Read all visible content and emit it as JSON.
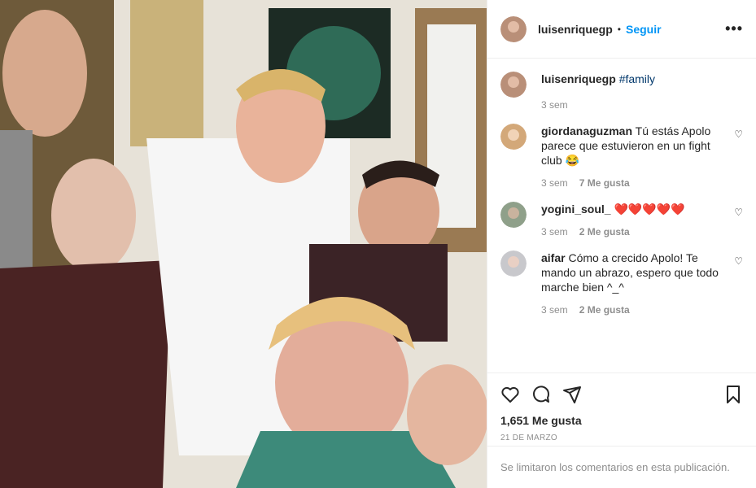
{
  "post": {
    "username": "luisenriquegp",
    "follow_label": "Seguir",
    "caption_tag": "#family",
    "caption_time": "3 sem",
    "likes": "1,651 Me gusta",
    "date": "21 DE MARZO",
    "comments_limited": "Se limitaron los comentarios en esta publicación."
  },
  "comments": [
    {
      "user": "giordanaguzman",
      "text": "Tú estás Apolo parece que estuvieron en un fight club 😂",
      "time": "3 sem",
      "likes": "7 Me gusta"
    },
    {
      "user": "yogini_soul_",
      "text": "❤️❤️❤️❤️❤️",
      "time": "3 sem",
      "likes": "2 Me gusta"
    },
    {
      "user": "aifar",
      "text": "Cómo a crecido Apolo! Te mando un abrazo, espero que todo marche bien ^_^",
      "time": "3 sem",
      "likes": "2 Me gusta"
    }
  ],
  "icons": {
    "like": "heart-icon",
    "comment": "comment-icon",
    "share": "share-icon",
    "save": "bookmark-icon",
    "more": "more-icon"
  }
}
